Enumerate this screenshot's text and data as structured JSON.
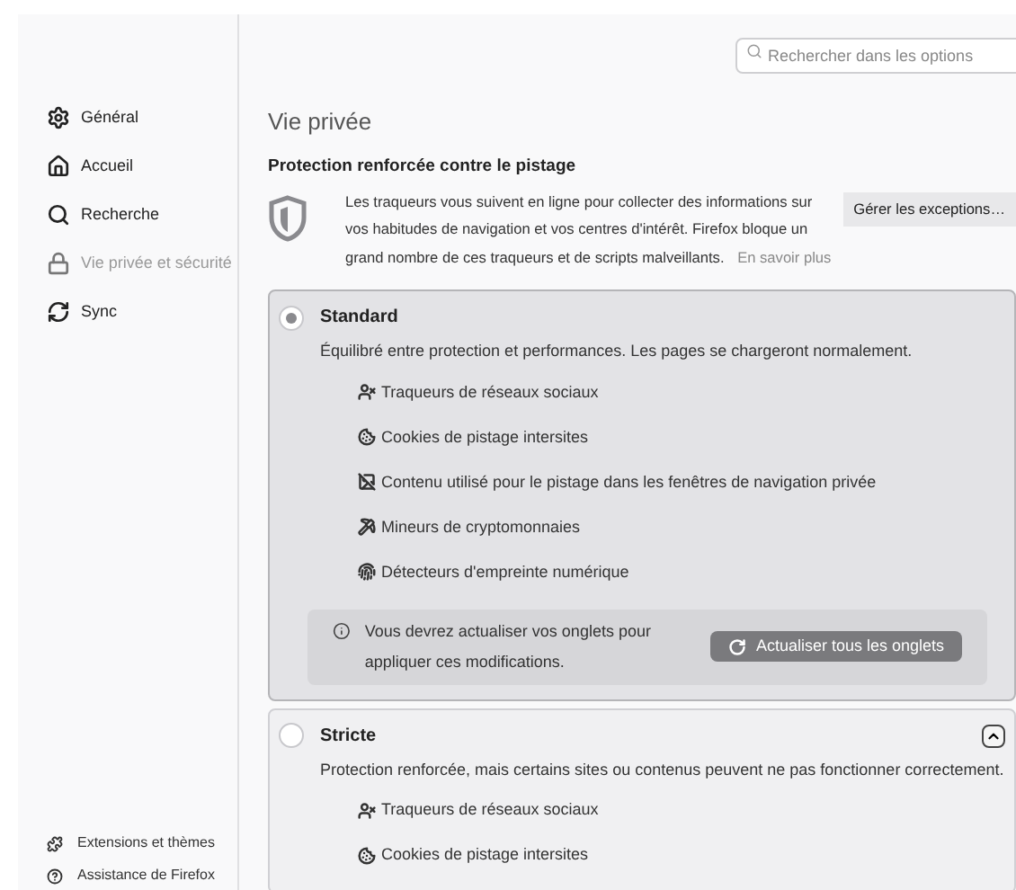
{
  "search": {
    "placeholder": "Rechercher dans les options"
  },
  "sidebar": {
    "items": [
      {
        "label": "Général",
        "selected": false
      },
      {
        "label": "Accueil",
        "selected": false
      },
      {
        "label": "Recherche",
        "selected": false
      },
      {
        "label": "Vie privée et sécurité",
        "selected": true
      },
      {
        "label": "Sync",
        "selected": false
      }
    ],
    "footer": [
      {
        "label": "Extensions et thèmes"
      },
      {
        "label": "Assistance de Firefox"
      }
    ]
  },
  "page_title": "Vie privée",
  "section": {
    "heading": "Protection renforcée contre le pistage",
    "description": "Les traqueurs vous suivent en ligne pour collecter des informations sur vos habitudes de navigation et vos centres d'intérêt. Firefox bloque un grand nombre de ces traqueurs et de scripts malveillants.",
    "link": "En savoir plus",
    "button": "Gérer les exceptions…"
  },
  "options": [
    {
      "label": "Standard",
      "selected": true,
      "description": "Équilibré entre protection et performances. Les pages se chargeront normalement.",
      "trackers": [
        {
          "kind": "social",
          "label": "Traqueurs de réseaux sociaux"
        },
        {
          "kind": "cookie",
          "label": "Cookies de pistage intersites"
        },
        {
          "kind": "content",
          "label": "Contenu utilisé pour le pistage dans les fenêtres de navigation privée"
        },
        {
          "kind": "crypto",
          "label": "Mineurs de cryptomonnaies"
        },
        {
          "kind": "fingerprint",
          "label": "Détecteurs d'empreinte numérique"
        }
      ],
      "notice": {
        "text": "Vous devrez actualiser vos onglets pour appliquer ces modifications.",
        "button": "Actualiser tous les onglets"
      }
    },
    {
      "label": "Stricte",
      "selected": false,
      "description": "Protection renforcée, mais certains sites ou contenus peuvent ne pas fonctionner correctement.",
      "trackers": [
        {
          "kind": "social",
          "label": "Traqueurs de réseaux sociaux"
        },
        {
          "kind": "cookie",
          "label": "Cookies de pistage intersites"
        }
      ],
      "collapsible": true
    }
  ]
}
